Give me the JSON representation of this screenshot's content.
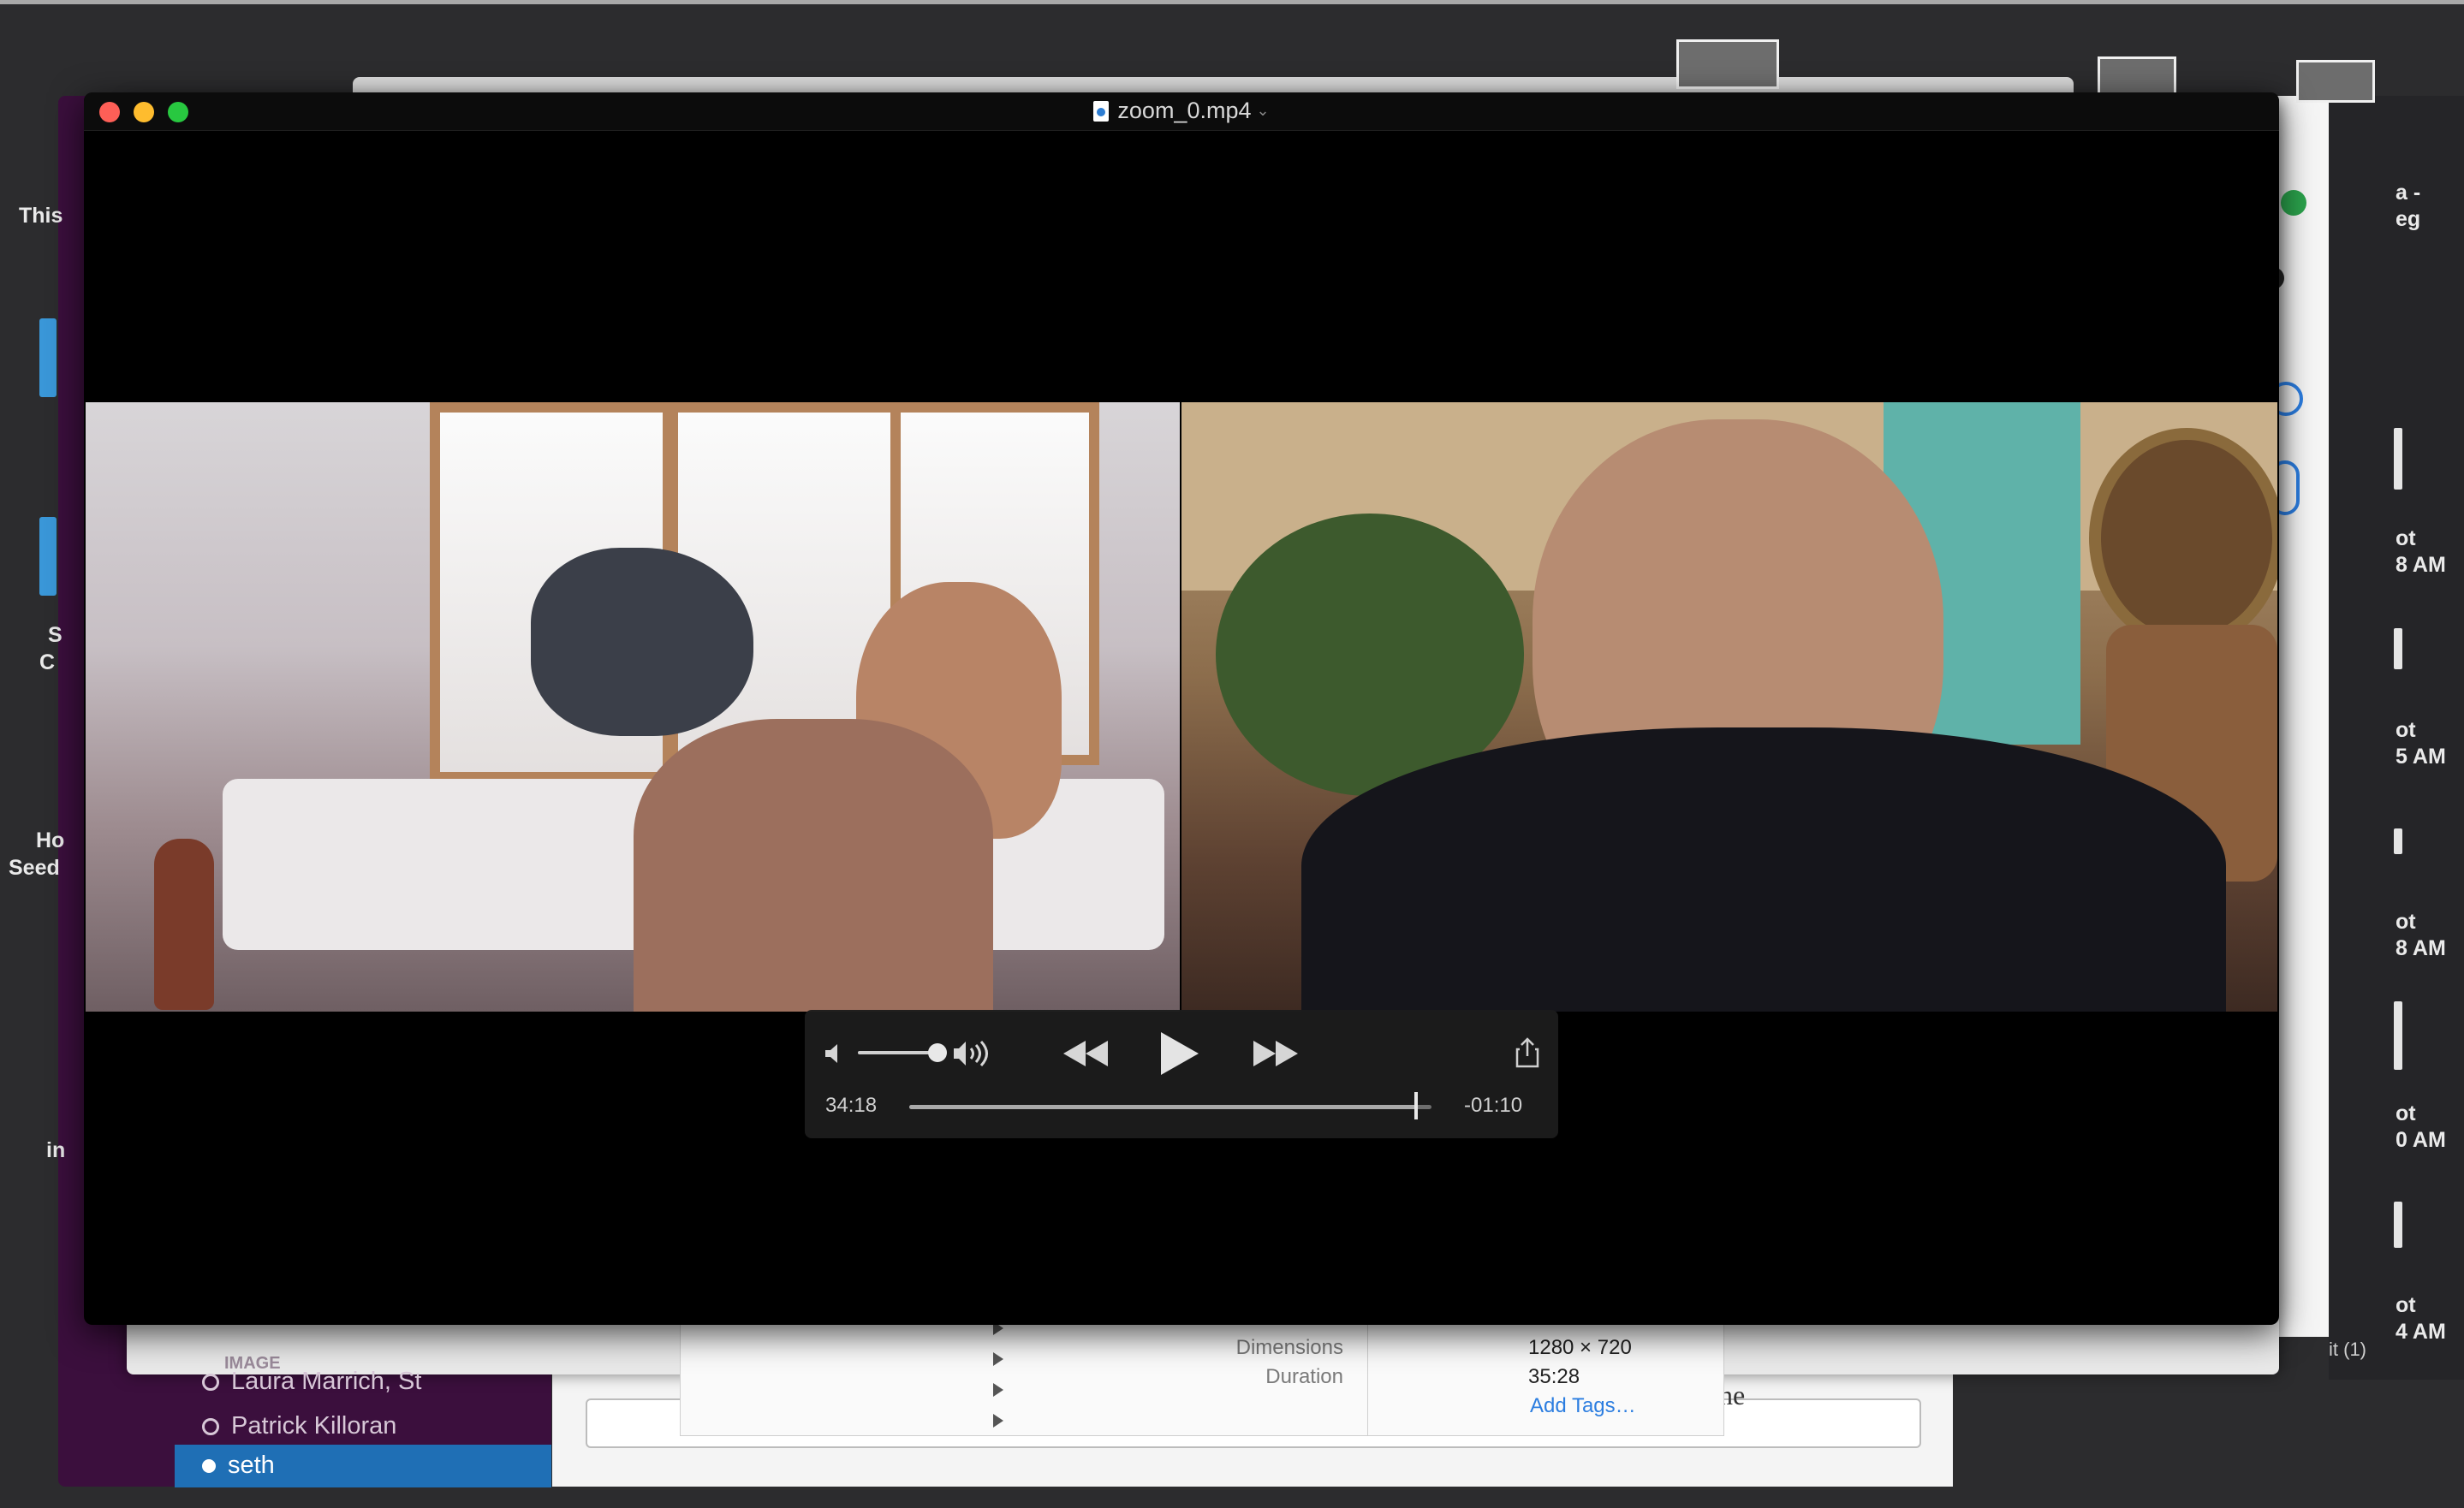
{
  "player": {
    "filename": "zoom_0.mp4",
    "elapsed": "34:18",
    "remaining": "-01:10",
    "progress_fraction": 0.97,
    "volume_fraction": 0.85
  },
  "info_panel": {
    "dimensions_label": "Dimensions",
    "dimensions_value": "1280 × 720",
    "duration_label": "Duration",
    "duration_value": "35:28",
    "add_tags": "Add Tags…"
  },
  "slack": {
    "items": [
      {
        "label": "Laura Marrich, St"
      },
      {
        "label": "Patrick Killoran"
      }
    ],
    "selected": "seth",
    "image_tag": "IMAGE"
  },
  "left_labels": {
    "this": "This",
    "s": "S",
    "c": "C",
    "ho": "Ho",
    "seed": "Seed",
    "in": "in"
  },
  "right_labels": [
    {
      "l1": "a -",
      "l2": "eg"
    },
    {
      "l1": "ot",
      "l2": "8 AM"
    },
    {
      "l1": "ot",
      "l2": "5 AM"
    },
    {
      "l1": "ot",
      "l2": "8 AM"
    },
    {
      "l1": "ot",
      "l2": "0 AM"
    },
    {
      "l1": "ot",
      "l2": "4 AM"
    }
  ],
  "right_footer": "it (1)",
  "doc_fragment": "ne",
  "colors": {
    "slack_sidebar": "#3b0f3d",
    "slack_selected": "#1f6fb5",
    "close": "#fe5f57",
    "minimize": "#febc2e",
    "zoom": "#28c840",
    "link": "#2b7de0"
  },
  "icons": [
    "mute-icon",
    "volume-icon",
    "rewind-icon",
    "play-icon",
    "fast-forward-icon",
    "share-icon"
  ]
}
